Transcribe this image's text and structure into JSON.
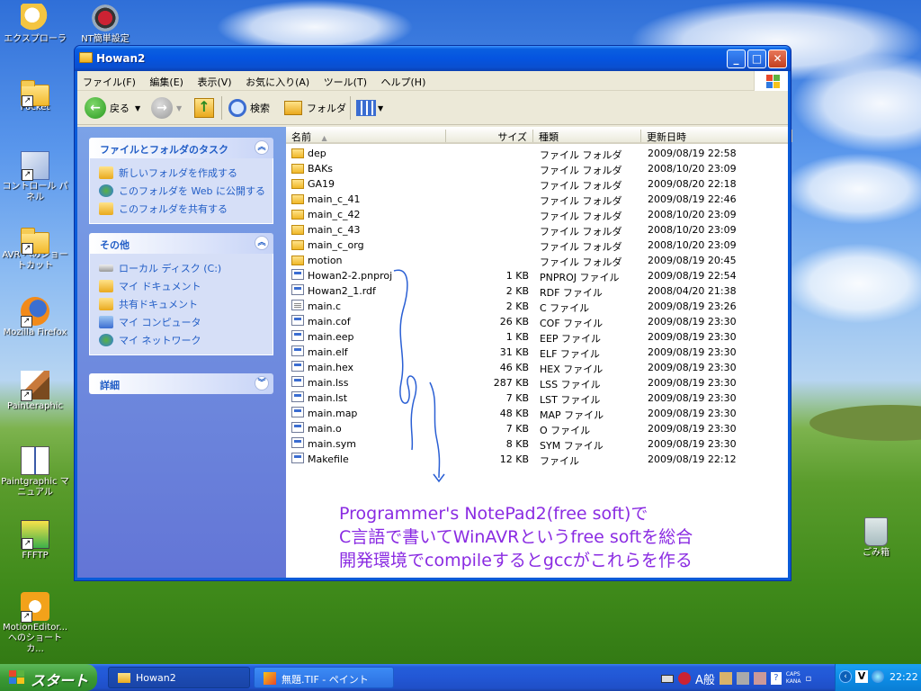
{
  "desktop": {
    "icons": [
      {
        "label": "エクスプローラ"
      },
      {
        "label": "NT簡単設定"
      },
      {
        "label": "Pocket"
      },
      {
        "label": "コントロール パネル"
      },
      {
        "label": "AVR へのショートカット"
      },
      {
        "label": "Mozilla Firefox"
      },
      {
        "label": "Painteraphic"
      },
      {
        "label": "Paintgraphic マニュアル"
      },
      {
        "label": "FFFTP"
      },
      {
        "label": "MotionEditor... へのショートカ..."
      },
      {
        "label": "ごみ箱"
      }
    ]
  },
  "window": {
    "title": "Howan2",
    "buttons": {
      "min": "_",
      "max": "□",
      "close": "✕"
    },
    "menu": [
      "ファイル(F)",
      "編集(E)",
      "表示(V)",
      "お気に入り(A)",
      "ツール(T)",
      "ヘルプ(H)"
    ],
    "toolbar": {
      "back": "戻る",
      "search": "検索",
      "folders": "フォルダ"
    },
    "taskpane": {
      "group1": {
        "title": "ファイルとフォルダのタスク",
        "items": [
          "新しいフォルダを作成する",
          "このフォルダを Web に公開する",
          "このフォルダを共有する"
        ]
      },
      "group2": {
        "title": "その他",
        "items": [
          "ローカル ディスク (C:)",
          "マイ ドキュメント",
          "共有ドキュメント",
          "マイ コンピュータ",
          "マイ ネットワーク"
        ]
      },
      "group3": {
        "title": "詳細"
      }
    },
    "columns": {
      "name": "名前",
      "size": "サイズ",
      "type": "種類",
      "modified": "更新日時"
    },
    "files": [
      {
        "name": "dep",
        "size": "",
        "type": "ファイル フォルダ",
        "date": "2009/08/19 22:58",
        "kind": "folder"
      },
      {
        "name": "BAKs",
        "size": "",
        "type": "ファイル フォルダ",
        "date": "2008/10/20 23:09",
        "kind": "folder"
      },
      {
        "name": "GA19",
        "size": "",
        "type": "ファイル フォルダ",
        "date": "2009/08/20 22:18",
        "kind": "folder"
      },
      {
        "name": "main_c_41",
        "size": "",
        "type": "ファイル フォルダ",
        "date": "2009/08/19 22:46",
        "kind": "folder"
      },
      {
        "name": "main_c_42",
        "size": "",
        "type": "ファイル フォルダ",
        "date": "2008/10/20 23:09",
        "kind": "folder"
      },
      {
        "name": "main_c_43",
        "size": "",
        "type": "ファイル フォルダ",
        "date": "2008/10/20 23:09",
        "kind": "folder"
      },
      {
        "name": "main_c_org",
        "size": "",
        "type": "ファイル フォルダ",
        "date": "2008/10/20 23:09",
        "kind": "folder"
      },
      {
        "name": "motion",
        "size": "",
        "type": "ファイル フォルダ",
        "date": "2009/08/19 20:45",
        "kind": "folder"
      },
      {
        "name": "Howan2-2.pnproj",
        "size": "1 KB",
        "type": "PNPROJ ファイル",
        "date": "2009/08/19 22:54",
        "kind": "file"
      },
      {
        "name": "Howan2_1.rdf",
        "size": "2 KB",
        "type": "RDF ファイル",
        "date": "2008/04/20 21:38",
        "kind": "file"
      },
      {
        "name": "main.c",
        "size": "2 KB",
        "type": "C ファイル",
        "date": "2009/08/19 23:26",
        "kind": "doc"
      },
      {
        "name": "main.cof",
        "size": "26 KB",
        "type": "COF ファイル",
        "date": "2009/08/19 23:30",
        "kind": "file"
      },
      {
        "name": "main.eep",
        "size": "1 KB",
        "type": "EEP ファイル",
        "date": "2009/08/19 23:30",
        "kind": "file"
      },
      {
        "name": "main.elf",
        "size": "31 KB",
        "type": "ELF ファイル",
        "date": "2009/08/19 23:30",
        "kind": "file"
      },
      {
        "name": "main.hex",
        "size": "46 KB",
        "type": "HEX ファイル",
        "date": "2009/08/19 23:30",
        "kind": "file"
      },
      {
        "name": "main.lss",
        "size": "287 KB",
        "type": "LSS ファイル",
        "date": "2009/08/19 23:30",
        "kind": "file"
      },
      {
        "name": "main.lst",
        "size": "7 KB",
        "type": "LST ファイル",
        "date": "2009/08/19 23:30",
        "kind": "file"
      },
      {
        "name": "main.map",
        "size": "48 KB",
        "type": "MAP ファイル",
        "date": "2009/08/19 23:30",
        "kind": "file"
      },
      {
        "name": "main.o",
        "size": "7 KB",
        "type": "O ファイル",
        "date": "2009/08/19 23:30",
        "kind": "file"
      },
      {
        "name": "main.sym",
        "size": "8 KB",
        "type": "SYM ファイル",
        "date": "2009/08/19 23:30",
        "kind": "file"
      },
      {
        "name": "Makefile",
        "size": "12 KB",
        "type": "ファイル",
        "date": "2009/08/19 22:12",
        "kind": "file"
      }
    ]
  },
  "annotation": [
    "Programmer's NotePad2(free soft)で",
    "C言語で書いてWinAVRというfree softを総合",
    "開発環境でcompileするとgccがこれらを作る"
  ],
  "taskbar": {
    "start": "スタート",
    "tasks": [
      "Howan2",
      "無題.TIF - ペイント"
    ],
    "ime": "A般",
    "caps": "CAPS",
    "kana": "KANA",
    "clock": "22:22"
  }
}
